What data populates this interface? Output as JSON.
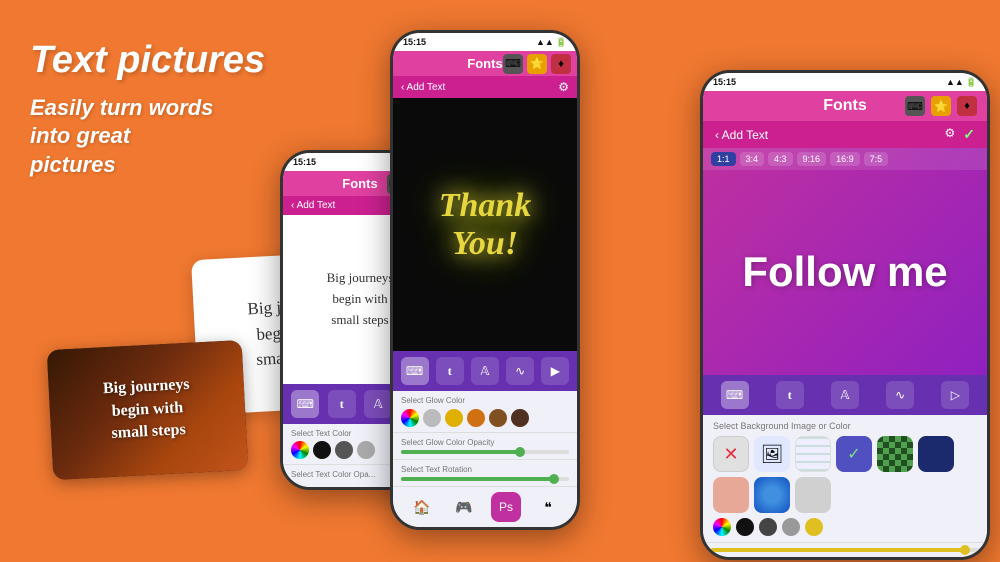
{
  "hero": {
    "title": "Text pictures",
    "subtitle": "Easily turn words\ninto great\npictures"
  },
  "card_white": {
    "text": "Big journeys\nbegin with\nsmall steps"
  },
  "card_dark": {
    "text": "Big journeys\nbegin with\nsmall steps"
  },
  "phone1": {
    "status_time": "15:15",
    "header_title": "Fonts",
    "sub_header": "Add Text",
    "canvas_text": "Big journeys\nbegin with\nsmall steps",
    "color_label": "Select Text Color",
    "opacity_label": "Select Text Color Opa..."
  },
  "phone2": {
    "status_time": "15:15",
    "header_title": "Fonts",
    "sub_header": "Add Text",
    "canvas_text1": "Thank",
    "canvas_text2": "You!",
    "glow_label": "Select Glow Color",
    "glow_opacity_label": "Select Glow Color Opacity",
    "rotation_label": "Select Text Rotation"
  },
  "phone3": {
    "status_time": "15:15",
    "header_title": "Fonts",
    "sub_header": "Add Text",
    "canvas_text": "Follow\nme",
    "ratios": [
      "1:1",
      "3:4",
      "4:3",
      "9:16",
      "16:9",
      "7:5"
    ],
    "bg_label": "Select Background Image or Color"
  },
  "colors": {
    "black": "#111111",
    "dark_gray": "#444444",
    "mid_gray": "#888888",
    "light_gray": "#cccccc",
    "yellow": "#e0c020",
    "peach": "#e8a898",
    "dark_blue": "#1a2a6c",
    "blue": "#2050c0"
  }
}
